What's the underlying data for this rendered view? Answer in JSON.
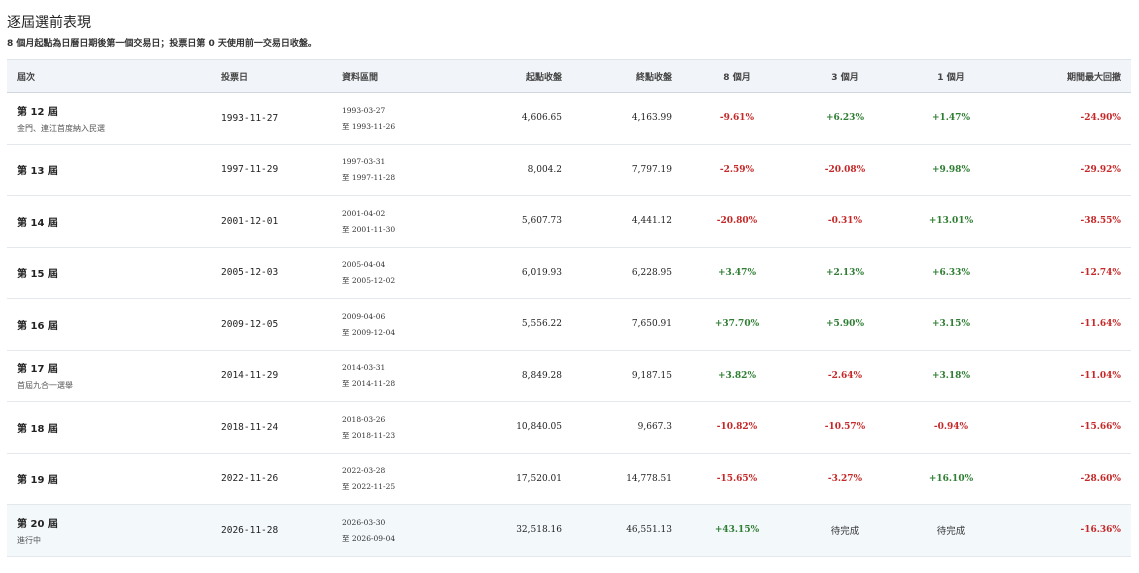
{
  "page": {
    "title": "逐屆選前表現",
    "subtitle": "8 個月起點為日曆日期後第一個交易日；投票日第 0 天使用前一交易日收盤。"
  },
  "colors": {
    "positive": "#2e7d32",
    "negative": "#c62828",
    "header_bg": "#f1f4f8",
    "current_row_bg": "#f3f8fb"
  },
  "table": {
    "headers": {
      "term": "屆次",
      "vote_date": "投票日",
      "range": "資料區間",
      "start_close": "起點收盤",
      "end_close": "終點收盤",
      "m8": "8 個月",
      "m3": "3 個月",
      "m1": "1 個月",
      "mdd": "期間最大回撤"
    },
    "rows": [
      {
        "term": "第 12 屆",
        "note": "金門、連江首度納入民選",
        "vote_date": "1993-11-27",
        "range_start": "1993-03-27",
        "range_end": "至 1993-11-26",
        "start_close": "4,606.65",
        "end_close": "4,163.99",
        "m8": "-9.61%",
        "m8_sign": "neg",
        "m3": "+6.23%",
        "m3_sign": "pos",
        "m1": "+1.47%",
        "m1_sign": "pos",
        "mdd": "-24.90%",
        "mdd_sign": "neg"
      },
      {
        "term": "第 13 屆",
        "note": "",
        "vote_date": "1997-11-29",
        "range_start": "1997-03-31",
        "range_end": "至 1997-11-28",
        "start_close": "8,004.2",
        "end_close": "7,797.19",
        "m8": "-2.59%",
        "m8_sign": "neg",
        "m3": "-20.08%",
        "m3_sign": "neg",
        "m1": "+9.98%",
        "m1_sign": "pos",
        "mdd": "-29.92%",
        "mdd_sign": "neg"
      },
      {
        "term": "第 14 屆",
        "note": "",
        "vote_date": "2001-12-01",
        "range_start": "2001-04-02",
        "range_end": "至 2001-11-30",
        "start_close": "5,607.73",
        "end_close": "4,441.12",
        "m8": "-20.80%",
        "m8_sign": "neg",
        "m3": "-0.31%",
        "m3_sign": "neg",
        "m1": "+13.01%",
        "m1_sign": "pos",
        "mdd": "-38.55%",
        "mdd_sign": "neg"
      },
      {
        "term": "第 15 屆",
        "note": "",
        "vote_date": "2005-12-03",
        "range_start": "2005-04-04",
        "range_end": "至 2005-12-02",
        "start_close": "6,019.93",
        "end_close": "6,228.95",
        "m8": "+3.47%",
        "m8_sign": "pos",
        "m3": "+2.13%",
        "m3_sign": "pos",
        "m1": "+6.33%",
        "m1_sign": "pos",
        "mdd": "-12.74%",
        "mdd_sign": "neg"
      },
      {
        "term": "第 16 屆",
        "note": "",
        "vote_date": "2009-12-05",
        "range_start": "2009-04-06",
        "range_end": "至 2009-12-04",
        "start_close": "5,556.22",
        "end_close": "7,650.91",
        "m8": "+37.70%",
        "m8_sign": "pos",
        "m3": "+5.90%",
        "m3_sign": "pos",
        "m1": "+3.15%",
        "m1_sign": "pos",
        "mdd": "-11.64%",
        "mdd_sign": "neg"
      },
      {
        "term": "第 17 屆",
        "note": "首屆九合一選舉",
        "vote_date": "2014-11-29",
        "range_start": "2014-03-31",
        "range_end": "至 2014-11-28",
        "start_close": "8,849.28",
        "end_close": "9,187.15",
        "m8": "+3.82%",
        "m8_sign": "pos",
        "m3": "-2.64%",
        "m3_sign": "neg",
        "m1": "+3.18%",
        "m1_sign": "pos",
        "mdd": "-11.04%",
        "mdd_sign": "neg"
      },
      {
        "term": "第 18 屆",
        "note": "",
        "vote_date": "2018-11-24",
        "range_start": "2018-03-26",
        "range_end": "至 2018-11-23",
        "start_close": "10,840.05",
        "end_close": "9,667.3",
        "m8": "-10.82%",
        "m8_sign": "neg",
        "m3": "-10.57%",
        "m3_sign": "neg",
        "m1": "-0.94%",
        "m1_sign": "neg",
        "mdd": "-15.66%",
        "mdd_sign": "neg"
      },
      {
        "term": "第 19 屆",
        "note": "",
        "vote_date": "2022-11-26",
        "range_start": "2022-03-28",
        "range_end": "至 2022-11-25",
        "start_close": "17,520.01",
        "end_close": "14,778.51",
        "m8": "-15.65%",
        "m8_sign": "neg",
        "m3": "-3.27%",
        "m3_sign": "neg",
        "m1": "+16.10%",
        "m1_sign": "pos",
        "mdd": "-28.60%",
        "mdd_sign": "neg"
      },
      {
        "term": "第 20 屆",
        "note": "進行中",
        "vote_date": "2026-11-28",
        "range_start": "2026-03-30",
        "range_end": "至 2026-09-04",
        "start_close": "32,518.16",
        "end_close": "46,551.13",
        "m8": "+43.15%",
        "m8_sign": "pos",
        "m3": "待完成",
        "m3_sign": "pending",
        "m1": "待完成",
        "m1_sign": "pending",
        "mdd": "-16.36%",
        "mdd_sign": "neg",
        "current": true
      }
    ]
  }
}
